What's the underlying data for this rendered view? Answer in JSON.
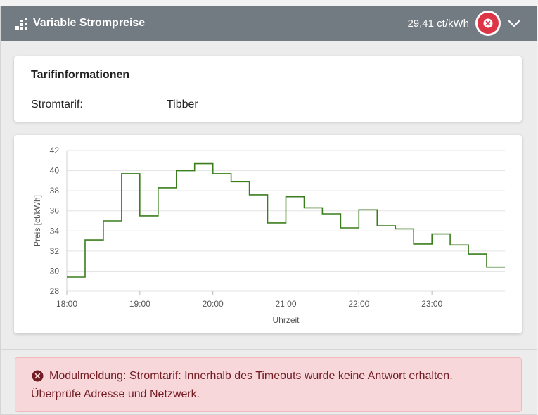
{
  "header": {
    "title": "Variable Strompreise",
    "price": "29,41 ct/kWh",
    "status_icon": "error-x-icon",
    "toggle_icon": "chevron-down-icon",
    "colors": {
      "header_bg": "#727a82",
      "error": "#dc3545"
    }
  },
  "tariff": {
    "heading": "Tarifinformationen",
    "label": "Stromtarif:",
    "value": "Tibber"
  },
  "chart_data": {
    "type": "line",
    "step": true,
    "xlabel": "Uhrzeit",
    "ylabel": "Preis [ct/kWh]",
    "ylim": [
      28,
      42
    ],
    "yticks": [
      "28",
      "30",
      "32",
      "34",
      "36",
      "38",
      "40",
      "42"
    ],
    "xticks": [
      "18:00",
      "19:00",
      "20:00",
      "21:00",
      "22:00",
      "23:00"
    ],
    "color": "#3a7d1c",
    "x": [
      "18:00",
      "18:15",
      "18:30",
      "18:45",
      "19:00",
      "19:15",
      "19:30",
      "19:45",
      "20:00",
      "20:15",
      "20:30",
      "20:45",
      "21:00",
      "21:15",
      "21:30",
      "21:45",
      "22:00",
      "22:15",
      "22:30",
      "22:45",
      "23:00",
      "23:15",
      "23:30",
      "23:45"
    ],
    "values": [
      29.4,
      33.1,
      35.0,
      39.7,
      35.5,
      38.3,
      40.0,
      40.7,
      39.7,
      38.9,
      37.6,
      34.8,
      37.4,
      36.3,
      35.7,
      34.3,
      36.1,
      34.5,
      34.2,
      32.7,
      33.7,
      32.6,
      31.7,
      30.4
    ]
  },
  "alert": {
    "icon": "error-circle-icon",
    "line1": "Modulmeldung: Stromtarif: Innerhalb des Timeouts wurde keine Antwort erhalten.",
    "line2": "Überprüfe Adresse und Netzwerk."
  }
}
